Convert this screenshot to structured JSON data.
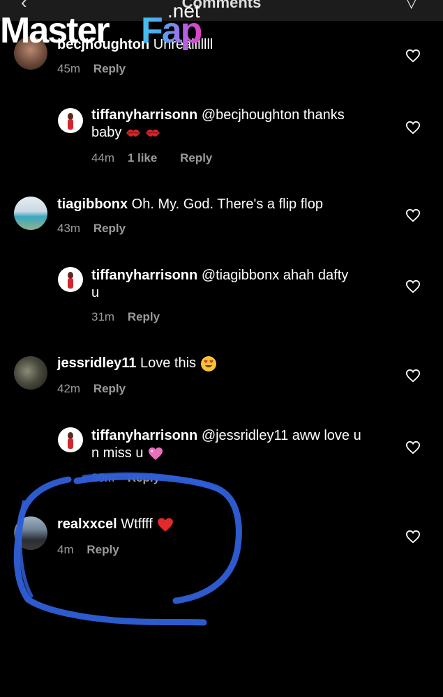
{
  "header": {
    "back_glyph": "‹",
    "title": "Comments",
    "send_glyph": "▽"
  },
  "watermark": {
    "master": "Master",
    "fap": "Fap",
    "net": ".net"
  },
  "comments": [
    {
      "username": "becjhoughton",
      "text": "Unrealllllll",
      "time": "45m",
      "reply": "Reply"
    },
    {
      "username": "tiffanyharrisonn",
      "text": "@becjhoughton thanks",
      "text2": "baby",
      "time": "44m",
      "likes": "1 like",
      "reply": "Reply"
    },
    {
      "username": "tiagibbonx",
      "text": "Oh. My. God. There's a flip flop",
      "time": "43m",
      "reply": "Reply"
    },
    {
      "username": "tiffanyharrisonn",
      "text": "@tiagibbonx ahah dafty",
      "text2": "u",
      "time": "31m",
      "reply": "Reply"
    },
    {
      "username": "jessridley11",
      "text": "Love this",
      "time": "42m",
      "reply": "Reply"
    },
    {
      "username": "tiffanyharrisonn",
      "text": "@jessridley11 aww love u",
      "text2": "n miss u",
      "time": "30m",
      "reply": "Reply"
    },
    {
      "username": "realxxcel",
      "text": "Wtffff",
      "time": "4m",
      "reply": "Reply"
    }
  ],
  "colors": {
    "background": "#000000",
    "meta": "#9a9a9a",
    "annotation": "#2f5fd8"
  },
  "icons": [
    "back-icon",
    "send-icon",
    "heart-outline-icon",
    "kiss-emoji-icon",
    "heart-eyes-emoji-icon",
    "red-heart-emoji-icon",
    "pink-heart-emoji-icon"
  ]
}
